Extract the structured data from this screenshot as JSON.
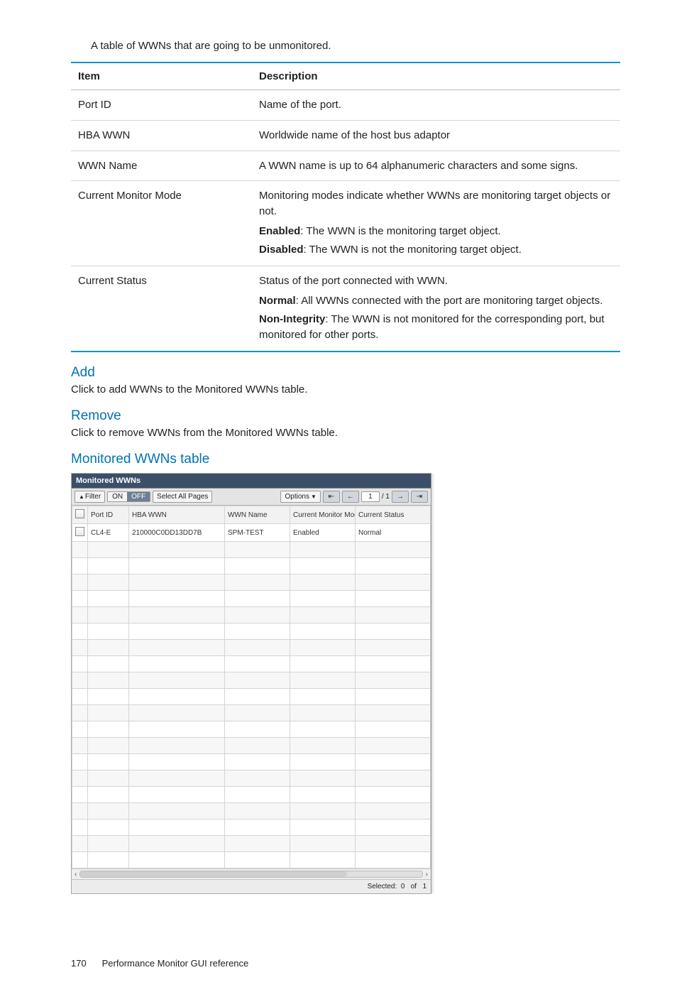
{
  "intro": "A table of WWNs that are going to be unmonitored.",
  "descTable": {
    "headers": {
      "item": "Item",
      "description": "Description"
    },
    "rows": [
      {
        "item": "Port ID",
        "desc": "Name of the port."
      },
      {
        "item": "HBA WWN",
        "desc": "Worldwide name of the host bus adaptor"
      },
      {
        "item": "WWN Name",
        "desc": "A WWN name is up to 64 alphanumeric characters and some signs."
      },
      {
        "item": "Current Monitor Mode",
        "desc_lines": [
          "Monitoring modes indicate whether WWNs are monitoring target objects or not.",
          {
            "b": "Enabled",
            "t": ": The WWN is the monitoring target object."
          },
          {
            "b": "Disabled",
            "t": ": The WWN is not the monitoring target object."
          }
        ]
      },
      {
        "item": "Current Status",
        "desc_lines": [
          "Status of the port connected with WWN.",
          {
            "b": "Normal",
            "t": ": All WWNs connected with the port are monitoring target objects."
          },
          {
            "b": "Non-Integrity",
            "t": ": The WWN is not monitored for the corresponding port, but monitored for other ports."
          }
        ]
      }
    ]
  },
  "sections": {
    "add": {
      "title": "Add",
      "body": "Click to add WWNs to the Monitored WWNs table."
    },
    "remove": {
      "title": "Remove",
      "body": "Click to remove WWNs from the Monitored WWNs table."
    },
    "monitored": {
      "title": "Monitored WWNs table"
    }
  },
  "app": {
    "title": "Monitored WWNs",
    "toolbar": {
      "filter": "Filter",
      "on": "ON",
      "off": "OFF",
      "selectAll": "Select All Pages",
      "options": "Options",
      "page": "1",
      "total": "/ 1"
    },
    "columns": [
      "",
      "Port ID",
      "HBA WWN",
      "WWN Name",
      "Current Monitor Mode",
      "Current Status"
    ],
    "row": {
      "portId": "CL4-E",
      "hba": "210000C0DD13DD7B",
      "name": "SPM-TEST",
      "mode": "Enabled",
      "status": "Normal"
    },
    "emptyRows": 20,
    "footer": {
      "selectedLabel": "Selected:",
      "selected": "0",
      "ofLabel": "of",
      "total": "1"
    }
  },
  "pageFooter": {
    "pageNum": "170",
    "title": "Performance Monitor GUI reference"
  }
}
